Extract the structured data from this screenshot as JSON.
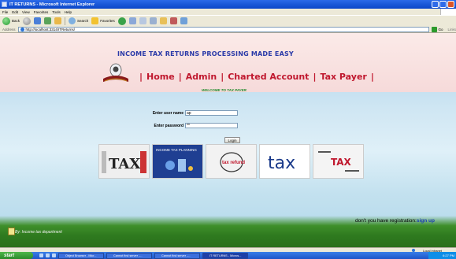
{
  "window": {
    "title": "IT RETURNS - Microsoft Internet Explorer"
  },
  "menu": [
    "File",
    "Edit",
    "View",
    "Favorites",
    "Tools",
    "Help"
  ],
  "toolbar": {
    "back": "Back",
    "search": "Search",
    "favorites": "Favorites"
  },
  "address": {
    "label": "Address",
    "url": "http://localhost:3314/ITReturns/",
    "go": "Go",
    "links": "Links"
  },
  "page": {
    "title": "INCOME TAX RETURNS PROCESSING MADE EASY",
    "nav": [
      "Home",
      "Admin",
      "Charted Account",
      "Tax Payer"
    ],
    "welcome": "WELCOME TO TAX PAYER",
    "login": {
      "username_label": "Enter user name",
      "username_value": "ap",
      "password_label": "Enter password",
      "password_value": "**",
      "button": "Login"
    },
    "tiles": [
      {
        "name": "tax-image-1",
        "text": "TAX"
      },
      {
        "name": "income-tax-planning-image",
        "text": "INCOME TAX PLANNING"
      },
      {
        "name": "tax-refund-image",
        "text": "tax refund"
      },
      {
        "name": "tax-words-image",
        "text": "tax"
      },
      {
        "name": "business-tax-image",
        "text": "TAX"
      }
    ],
    "register_text": "don't you have registration:",
    "register_link": "sign up",
    "footer": "By: Income tax department"
  },
  "status": {
    "zone": "Local intranet"
  },
  "taskbar": {
    "start": "start",
    "tasks": [
      "Object Browser - Micr...",
      "Cannot find server -...",
      "Cannot find server -...",
      "IT RETURNS - Micros..."
    ],
    "clock": "6:27 PM"
  },
  "colors": {
    "title_blue": "#2a3aa8",
    "nav_red": "#c0182e",
    "welcome_green": "#1e8a2a"
  }
}
